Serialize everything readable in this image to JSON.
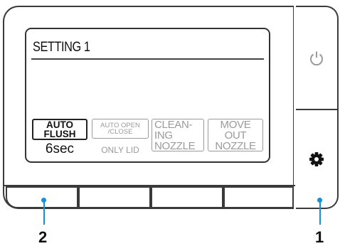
{
  "display": {
    "title": "SETTING 1",
    "softkeys": [
      {
        "lines": [
          "AUTO",
          "FLUSH"
        ],
        "sub": "6sec",
        "state": "active"
      },
      {
        "lines": [
          "AUTO OPEN",
          "/CLOSE"
        ],
        "sub": "ONLY LID",
        "state": "inactive"
      },
      {
        "lines": [
          "CLEAN-",
          "ING",
          "NOZZLE"
        ],
        "state": "inactive"
      },
      {
        "lines": [
          "MOVE",
          "OUT",
          "NOZZLE"
        ],
        "state": "inactive"
      }
    ]
  },
  "side_buttons": {
    "power": "power-icon",
    "settings": "gear-icon"
  },
  "callouts": {
    "left": "2",
    "right": "1"
  },
  "colors": {
    "callout": "#1b8fd0",
    "inactive_text": "#9a9a9a",
    "outline": "#3a3a3a"
  }
}
